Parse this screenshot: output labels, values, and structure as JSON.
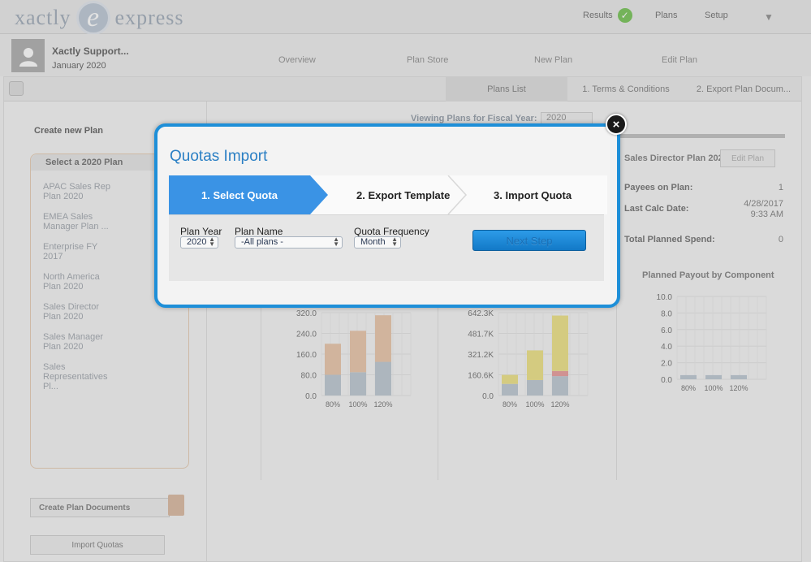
{
  "brand": {
    "logo_left": "xactly",
    "logo_letter": "e",
    "logo_right": "express"
  },
  "topnav": {
    "results": "Results",
    "plans": "Plans",
    "setup": "Setup"
  },
  "user": {
    "name": "Xactly Support...",
    "date": "January 2020"
  },
  "subtabs": [
    "Overview",
    "Plan Store",
    "New Plan",
    "Edit Plan"
  ],
  "content_tabs": [
    "Plans List",
    "1. Terms & Conditions",
    "2. Export Plan Docum..."
  ],
  "left": {
    "create_plan": "Create new Plan",
    "list_header": "Select a 2020 Plan",
    "plans": [
      [
        "APAC Sales Rep",
        "Plan 2020"
      ],
      [
        "EMEA Sales",
        "Manager Plan ..."
      ],
      [
        "Enterprise FY",
        "2017"
      ],
      [
        "North America",
        "Plan 2020"
      ],
      [
        "Sales Director",
        "Plan 2020"
      ],
      [
        "Sales Manager",
        "Plan 2020"
      ],
      [
        "Sales",
        "Representatives",
        "Pl..."
      ]
    ],
    "create_docs": "Create Plan Documents",
    "import_quotas": "Import Quotas"
  },
  "fiscal": {
    "label": "Viewing Plans for Fiscal Year:",
    "year": "2020"
  },
  "summary": {
    "plan_title": "Sales Director Plan 202",
    "edit_plan": "Edit Plan",
    "payees_label": "Payees on Plan:",
    "payees_value": "1",
    "last_calc_label": "Last Calc Date:",
    "last_calc_date": "4/28/2017",
    "last_calc_time": "9:33 AM",
    "spend_label": "Total Planned Spend:",
    "spend_value": "0",
    "payout_title": "Planned Payout by Component"
  },
  "chart_data": [
    {
      "type": "bar",
      "title": "",
      "categories": [
        "80%",
        "100%",
        "120%"
      ],
      "y_ticks": [
        "320.0",
        "240.0",
        "160.0",
        "80.0",
        "0.0"
      ],
      "ylim": [
        0,
        320
      ],
      "series": [
        {
          "values": [
            80,
            90,
            130
          ],
          "color": "#b9c4cf"
        },
        {
          "values": [
            120,
            160,
            180
          ],
          "color": "#e8c2a3"
        }
      ]
    },
    {
      "type": "bar",
      "title": "",
      "categories": [
        "80%",
        "100%",
        "120%"
      ],
      "y_ticks": [
        "642.3K",
        "481.7K",
        "321.2K",
        "160.6K",
        "0.0"
      ],
      "ylim": [
        0,
        642.3
      ],
      "series": [
        {
          "values": [
            90,
            120,
            150
          ],
          "color": "#b9c4cf"
        },
        {
          "values": [
            0,
            0,
            40
          ],
          "color": "#e79595"
        },
        {
          "values": [
            70,
            230,
            430
          ],
          "color": "#ece07d"
        }
      ]
    },
    {
      "type": "bar",
      "title": "Planned Payout by Component",
      "categories": [
        "80%",
        "100%",
        "120%"
      ],
      "y_ticks": [
        "10.0",
        "8.0",
        "6.0",
        "4.0",
        "2.0",
        "0.0"
      ],
      "ylim": [
        0,
        10
      ],
      "series": [
        {
          "values": [
            0.5,
            0.5,
            0.5
          ],
          "color": "#b9c4cf"
        }
      ]
    }
  ],
  "modal": {
    "title": "Quotas Import",
    "close": "×",
    "steps": [
      "1. Select Quota",
      "2. Export Template",
      "3. Import Quota"
    ],
    "plan_year_label": "Plan Year",
    "plan_year_value": "2020",
    "plan_name_label": "Plan Name",
    "plan_name_value": "-All plans -",
    "quota_freq_label": "Quota Frequency",
    "quota_freq_value": "Month",
    "next_button": "Next Step",
    "colors": {
      "accent": "#1e8fd8",
      "active_step": "#3a93e5"
    }
  }
}
